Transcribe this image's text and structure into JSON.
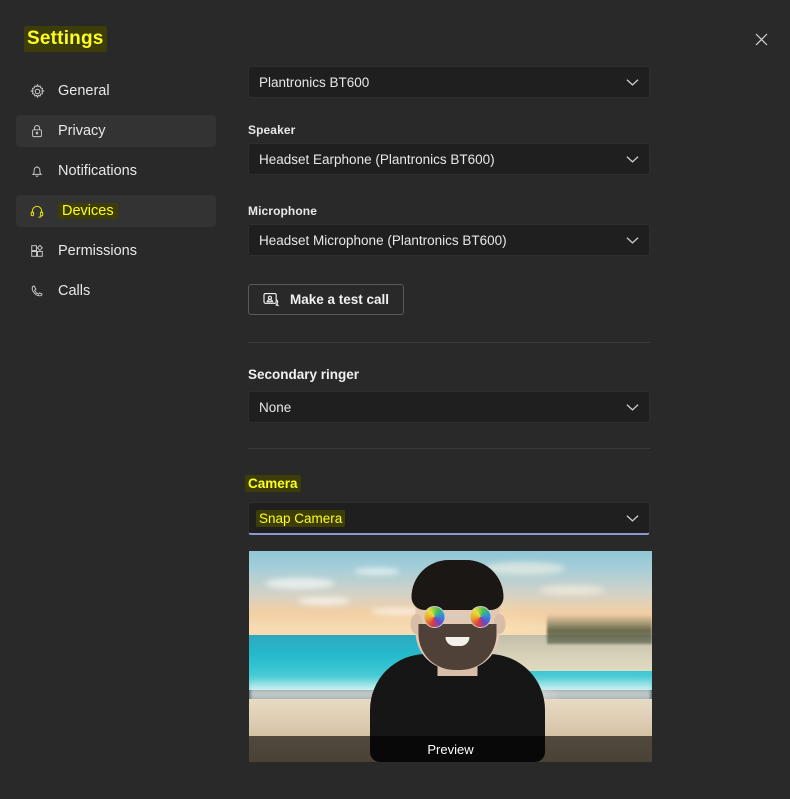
{
  "window": {
    "title": "Settings",
    "close_icon": "close-icon"
  },
  "sidebar": {
    "items": [
      {
        "label": "General",
        "icon": "gear-icon",
        "selected": false,
        "highlighted": false
      },
      {
        "label": "Privacy",
        "icon": "lock-icon",
        "selected": true,
        "highlighted": false
      },
      {
        "label": "Notifications",
        "icon": "bell-icon",
        "selected": false,
        "highlighted": false
      },
      {
        "label": "Devices",
        "icon": "headset-icon",
        "selected": true,
        "highlighted": true
      },
      {
        "label": "Permissions",
        "icon": "apps-grid-icon",
        "selected": false,
        "highlighted": false
      },
      {
        "label": "Calls",
        "icon": "phone-icon",
        "selected": false,
        "highlighted": false
      }
    ]
  },
  "main": {
    "audio_device": {
      "value": "Plantronics BT600",
      "chevron_icon": "chevron-down-icon"
    },
    "speaker": {
      "label": "Speaker",
      "value": "Headset Earphone (Plantronics BT600)",
      "chevron_icon": "chevron-down-icon"
    },
    "microphone": {
      "label": "Microphone",
      "value": "Headset Microphone (Plantronics BT600)",
      "chevron_icon": "chevron-down-icon"
    },
    "test_call": {
      "label": "Make a test call",
      "icon": "test-call-icon"
    },
    "secondary_ringer": {
      "heading": "Secondary ringer",
      "value": "None",
      "chevron_icon": "chevron-down-icon"
    },
    "camera": {
      "heading": "Camera",
      "heading_highlighted": true,
      "value": "Snap Camera",
      "value_highlighted": true,
      "focused": true,
      "chevron_icon": "chevron-down-icon"
    },
    "preview": {
      "label": "Preview",
      "description": "beach-sunset-virtual-background-with-person-wearing-rainbow-sunglasses"
    }
  },
  "colors": {
    "window_bg": "#292929",
    "row_selected_bg": "#333333",
    "dropdown_bg": "#1f1f1f",
    "divider": "#3b3b3b",
    "highlight_text": "#fdfd22",
    "highlight_bg": "#3d3d07",
    "focus_underline": "#9096d4",
    "text": "#e8e8e8"
  }
}
